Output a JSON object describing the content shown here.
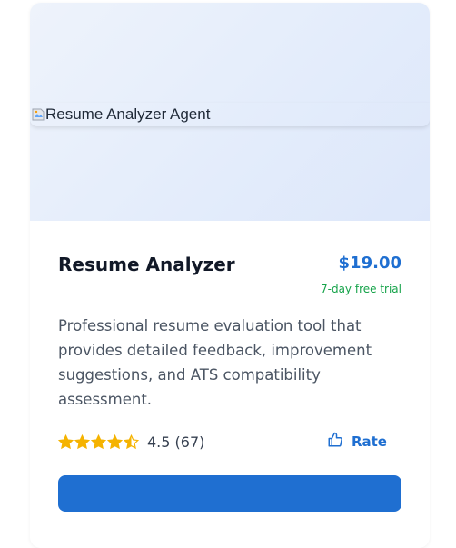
{
  "card": {
    "image_alt": "Resume Analyzer Agent",
    "title": "Resume Analyzer",
    "price": "$19.00",
    "trial": "7-day free trial",
    "description": "Professional resume evaluation tool that provides detailed feedback, improvement suggestions, and ATS compatibility assessment.",
    "rating": {
      "value": 4.5,
      "display": "4.5 (67)",
      "max": 5
    },
    "rate_label": "Rate"
  },
  "colors": {
    "accent": "#1f6fd1",
    "trial_green": "#16a34a",
    "star_gold": "#f5b301"
  },
  "icons": [
    "broken-image-icon",
    "star-icon",
    "half-star-icon",
    "thumbs-up-icon"
  ]
}
